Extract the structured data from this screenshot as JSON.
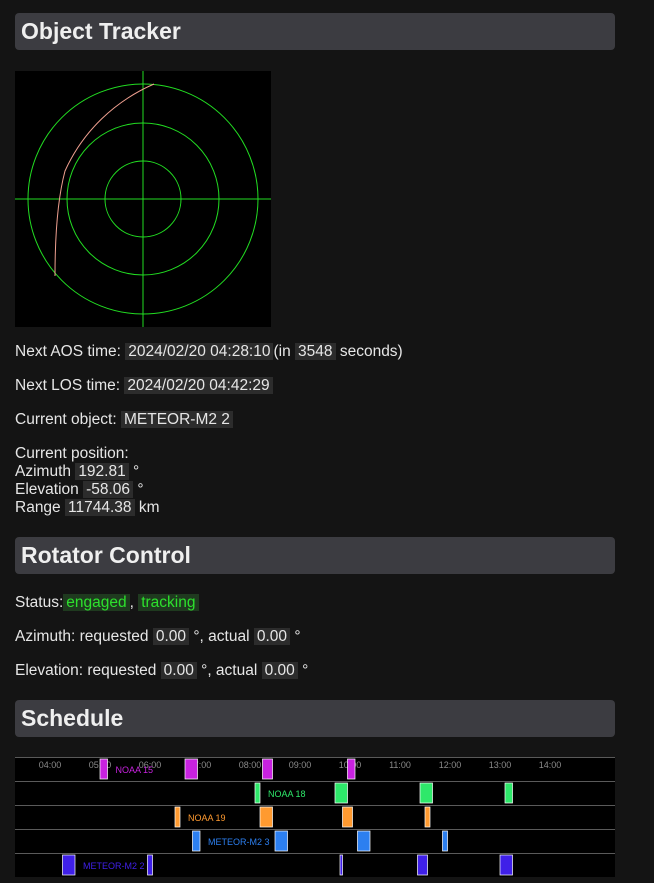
{
  "tracker": {
    "title": "Object Tracker",
    "aos_label": "Next AOS time:",
    "aos_value": "2024/02/20 04:28:10",
    "aos_in": "(in",
    "aos_seconds": "3548",
    "aos_seconds_suffix": "seconds)",
    "los_label": "Next LOS time:",
    "los_value": "2024/02/20 04:42:29",
    "object_label": "Current object:",
    "object_value": "METEOR-M2 2",
    "position_label": "Current position:",
    "azimuth_label": "Azimuth",
    "azimuth_value": "192.81",
    "azimuth_unit": "°",
    "elevation_label": "Elevation",
    "elevation_value": "-58.06",
    "elevation_unit": "°",
    "range_label": "Range",
    "range_value": "11744.38",
    "range_unit": "km"
  },
  "polar_plot": {
    "ring_color": "#22dd22",
    "track_color": "#f0a090"
  },
  "rotator": {
    "title": "Rotator Control",
    "status_label": "Status:",
    "status_engaged": "engaged",
    "status_sep": ",",
    "status_tracking": "tracking",
    "az_label": "Azimuth: requested",
    "az_requested": "0.00",
    "az_mid": "°, actual",
    "az_actual": "0.00",
    "az_unit": "°",
    "el_label": "Elevation: requested",
    "el_requested": "0.00",
    "el_mid": "°, actual",
    "el_actual": "0.00",
    "el_unit": "°"
  },
  "schedule": {
    "title": "Schedule",
    "hours": [
      "04:00",
      "05:00",
      "06:00",
      "07:00",
      "08:00",
      "09:00",
      "10:00",
      "11:00",
      "12:00",
      "13:00",
      "14:00"
    ],
    "rows": [
      {
        "name": "NOAA 15",
        "color": "#c822e0",
        "passes": [
          [
            5.0,
            5.15
          ],
          [
            6.7,
            6.95
          ],
          [
            8.25,
            8.45
          ],
          [
            9.95,
            10.1
          ]
        ]
      },
      {
        "name": "NOAA 18",
        "color": "#2ee86a",
        "passes": [
          [
            8.1,
            8.2
          ],
          [
            9.7,
            9.95
          ],
          [
            11.4,
            11.65
          ],
          [
            13.1,
            13.25
          ]
        ]
      },
      {
        "name": "NOAA 19",
        "color": "#ff9a30",
        "passes": [
          [
            6.5,
            6.6
          ],
          [
            8.2,
            8.45
          ],
          [
            9.85,
            10.05
          ],
          [
            11.5,
            11.6
          ]
        ]
      },
      {
        "name": "METEOR-M2 3",
        "color": "#2c7ff0",
        "passes": [
          [
            6.85,
            7.0
          ],
          [
            8.5,
            8.75
          ],
          [
            10.15,
            10.4
          ],
          [
            11.85,
            11.95
          ]
        ]
      },
      {
        "name": "METEOR-M2 2",
        "color": "#3f20e8",
        "passes": [
          [
            4.25,
            4.5
          ],
          [
            5.95,
            6.05
          ],
          [
            9.8,
            9.85
          ],
          [
            11.35,
            11.55
          ],
          [
            13.0,
            13.25
          ]
        ]
      }
    ]
  }
}
